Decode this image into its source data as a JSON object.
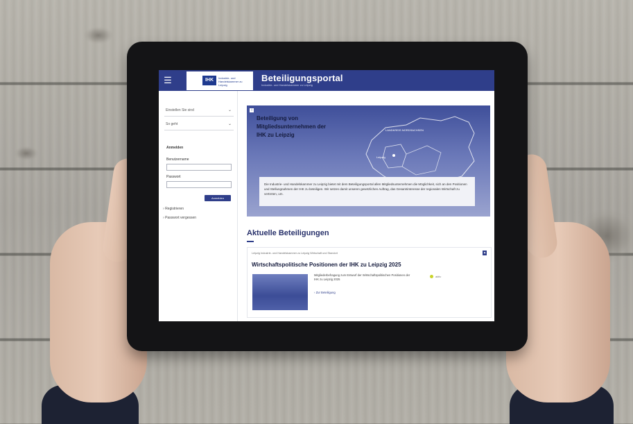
{
  "portal": {
    "title": "Beteiligungsportal",
    "subtitle": "Industrie- und Handelskammer zu Leipzig",
    "logo_badge": "IHK",
    "logo_text": "Industrie- und Handelskammer zu Leipzig"
  },
  "sidebar": {
    "select1": "Einstellen Sie sind",
    "select2": "So geht",
    "login_heading": "Anmelden",
    "username_label": "Benutzername",
    "password_label": "Passwort",
    "login_button": "Anmelden",
    "register_link": "Registrieren",
    "forgot_link": "Passwort vergessen"
  },
  "hero": {
    "title": "Beteiligung von Mitgliedsunternehmen der IHK zu Leipzig",
    "map_label_region": "LANDKREIS NORDSACHSEN",
    "map_label_city": "Leipzig",
    "text": "Die Industrie- und Handelskammer zu Leipzig bietet mit dem Beteiligungsportal allen Mitgliedsunternehmen die Möglichkeit, sich an den Positionen und Stellungnahmen der IHK zu beteiligen. Wir setzen damit unseren gesetzlichen Auftrag, das Gesamtinteresse der regionalen Wirtschaft zu vertreten, um."
  },
  "section": {
    "title": "Aktuelle Beteiligungen"
  },
  "card": {
    "meta": "Leipzig   Industrie- und Handelskammer zu Leipzig   Wirtschaft und Standort",
    "title": "Wirtschaftspolitische Positionen der IHK zu Leipzig 2025",
    "desc": "Mitgliederbefragung zum Entwurf der Wirtschaftspolitischen Positionen der IHK zu Leipzig 2025",
    "link": "Zur Beteiligung",
    "status": "aktiv"
  },
  "colors": {
    "brand": "#2f3e8a",
    "status": "#c9d32a"
  }
}
